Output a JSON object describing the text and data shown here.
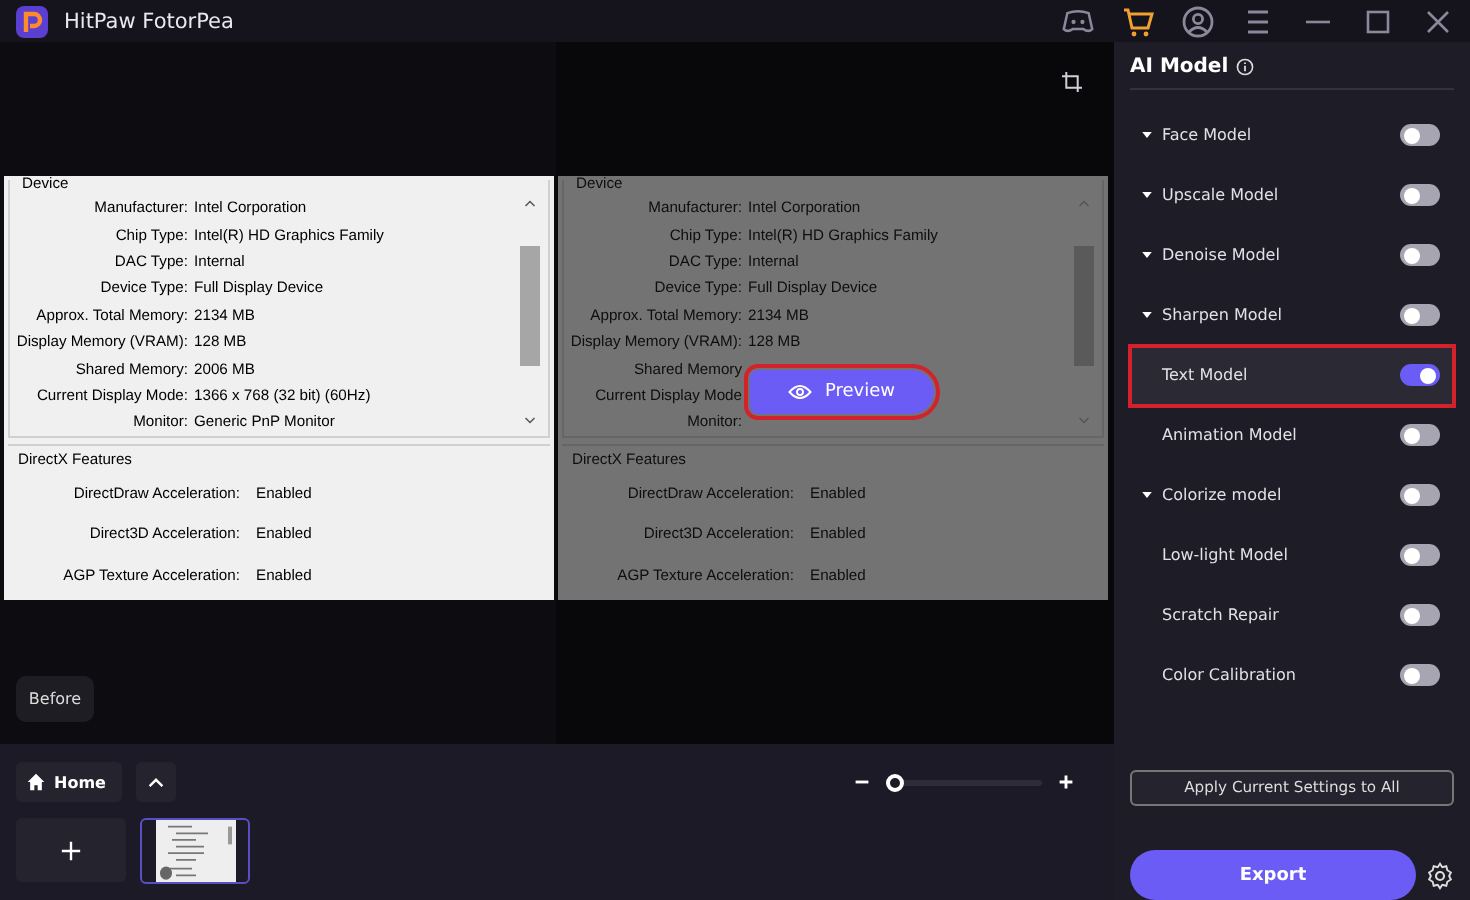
{
  "window": {
    "title": "HitPaw FotorPea"
  },
  "compare": {
    "panes": [
      {
        "dimmed": false,
        "device_title": "Device",
        "directx_title": "DirectX Features",
        "device_rows": [
          {
            "label": "Manufacturer:",
            "value": "Intel Corporation"
          },
          {
            "label": "Chip Type:",
            "value": "Intel(R) HD Graphics Family"
          },
          {
            "label": "DAC Type:",
            "value": "Internal"
          },
          {
            "label": "Device Type:",
            "value": "Full Display Device"
          },
          {
            "label": "Approx. Total Memory:",
            "value": "2134 MB"
          },
          {
            "label": "Display Memory (VRAM):",
            "value": "128 MB"
          },
          {
            "label": "Shared Memory:",
            "value": "2006 MB"
          },
          {
            "label": "Current Display Mode:",
            "value": "1366 x 768 (32 bit) (60Hz)"
          },
          {
            "label": "Monitor:",
            "value": "Generic PnP Monitor"
          }
        ],
        "directx_rows": [
          {
            "label": "DirectDraw Acceleration:",
            "value": "Enabled"
          },
          {
            "label": "Direct3D Acceleration:",
            "value": "Enabled"
          },
          {
            "label": "AGP Texture Acceleration:",
            "value": "Enabled"
          }
        ]
      },
      {
        "dimmed": true,
        "device_title": "Device",
        "directx_title": "DirectX Features",
        "device_rows": [
          {
            "label": "Manufacturer:",
            "value": "Intel Corporation"
          },
          {
            "label": "Chip Type:",
            "value": "Intel(R) HD Graphics Family"
          },
          {
            "label": "DAC Type:",
            "value": "Internal"
          },
          {
            "label": "Device Type:",
            "value": "Full Display Device"
          },
          {
            "label": "Approx. Total Memory:",
            "value": "2134 MB"
          },
          {
            "label": "Display Memory (VRAM):",
            "value": "128 MB"
          },
          {
            "label": "Shared Memory"
          },
          {
            "label": "Current Display Mode"
          },
          {
            "label": "Monitor:"
          }
        ],
        "directx_rows": [
          {
            "label": "DirectDraw Acceleration:",
            "value": "Enabled"
          },
          {
            "label": "Direct3D Acceleration:",
            "value": "Enabled"
          },
          {
            "label": "AGP Texture Acceleration:",
            "value": "Enabled"
          }
        ]
      }
    ],
    "before_button": "Before",
    "preview_button": {
      "label": "Preview",
      "highlighted": true
    }
  },
  "bottom_bar": {
    "home_button": "Home",
    "zoom": {
      "level": 0
    }
  },
  "ai_model": {
    "title": "AI Model",
    "items": [
      {
        "label": "Face Model",
        "expandable": true,
        "on": false,
        "selected": false
      },
      {
        "label": "Upscale Model",
        "expandable": true,
        "on": false,
        "selected": false
      },
      {
        "label": "Denoise Model",
        "expandable": true,
        "on": false,
        "selected": false
      },
      {
        "label": "Sharpen Model",
        "expandable": true,
        "on": false,
        "selected": false
      },
      {
        "label": "Text Model",
        "expandable": false,
        "on": true,
        "selected": true
      },
      {
        "label": "Animation Model",
        "expandable": false,
        "on": false,
        "selected": false
      },
      {
        "label": "Colorize model",
        "expandable": true,
        "on": false,
        "selected": false
      },
      {
        "label": "Low-light Model",
        "expandable": false,
        "on": false,
        "selected": false
      },
      {
        "label": "Scratch Repair",
        "expandable": false,
        "on": false,
        "selected": false
      },
      {
        "label": "Color Calibration",
        "expandable": false,
        "on": false,
        "selected": false
      }
    ],
    "apply_button": "Apply Current Settings to All",
    "export_button": "Export"
  }
}
